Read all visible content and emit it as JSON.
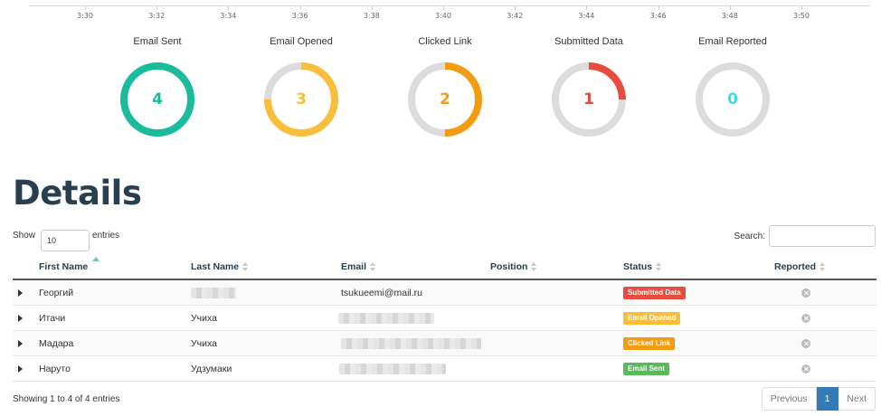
{
  "timeline": {
    "ticks": [
      "3:30",
      "3:32",
      "3:34",
      "3:36",
      "3:38",
      "3:40",
      "3:42",
      "3:44",
      "3:46",
      "3:48",
      "3:50"
    ]
  },
  "stats": [
    {
      "title": "Email Sent",
      "value": "4",
      "fraction": 1.0,
      "color": "#1abc9c"
    },
    {
      "title": "Email Opened",
      "value": "3",
      "fraction": 0.75,
      "color": "#f9bf3b"
    },
    {
      "title": "Clicked Link",
      "value": "2",
      "fraction": 0.5,
      "color": "#f39c12"
    },
    {
      "title": "Submitted Data",
      "value": "1",
      "fraction": 0.25,
      "color": "#e74c3c"
    },
    {
      "title": "Email Reported",
      "value": "0",
      "fraction": 0.0,
      "color": "#45d6ef"
    }
  ],
  "details": {
    "title": "Details",
    "show_label": "Show",
    "entries_value": "10",
    "entries_label": "entries",
    "search_label": "Search:"
  },
  "table": {
    "headers": [
      "First Name",
      "Last Name",
      "Email",
      "Position",
      "Status",
      "Reported"
    ],
    "rows": [
      {
        "first_name": "Георгий",
        "last_name": "",
        "email": "tsukueemi@mail.ru",
        "position": "",
        "status": "Submitted Data",
        "status_color": "#e74c3c"
      },
      {
        "first_name": "Итачи",
        "last_name": "Учиха",
        "email": "",
        "position": "",
        "status": "Email Opened",
        "status_color": "#f9bf3b"
      },
      {
        "first_name": "Мадара",
        "last_name": "Учиха",
        "email": "",
        "position": "",
        "status": "Clicked Link",
        "status_color": "#f39c12"
      },
      {
        "first_name": "Наруто",
        "last_name": "Удзумаки",
        "email": "",
        "position": "",
        "status": "Email Sent",
        "status_color": "#5cb85c"
      }
    ]
  },
  "footer": {
    "info": "Showing 1 to 4 of 4 entries",
    "previous": "Previous",
    "page": "1",
    "next": "Next"
  }
}
